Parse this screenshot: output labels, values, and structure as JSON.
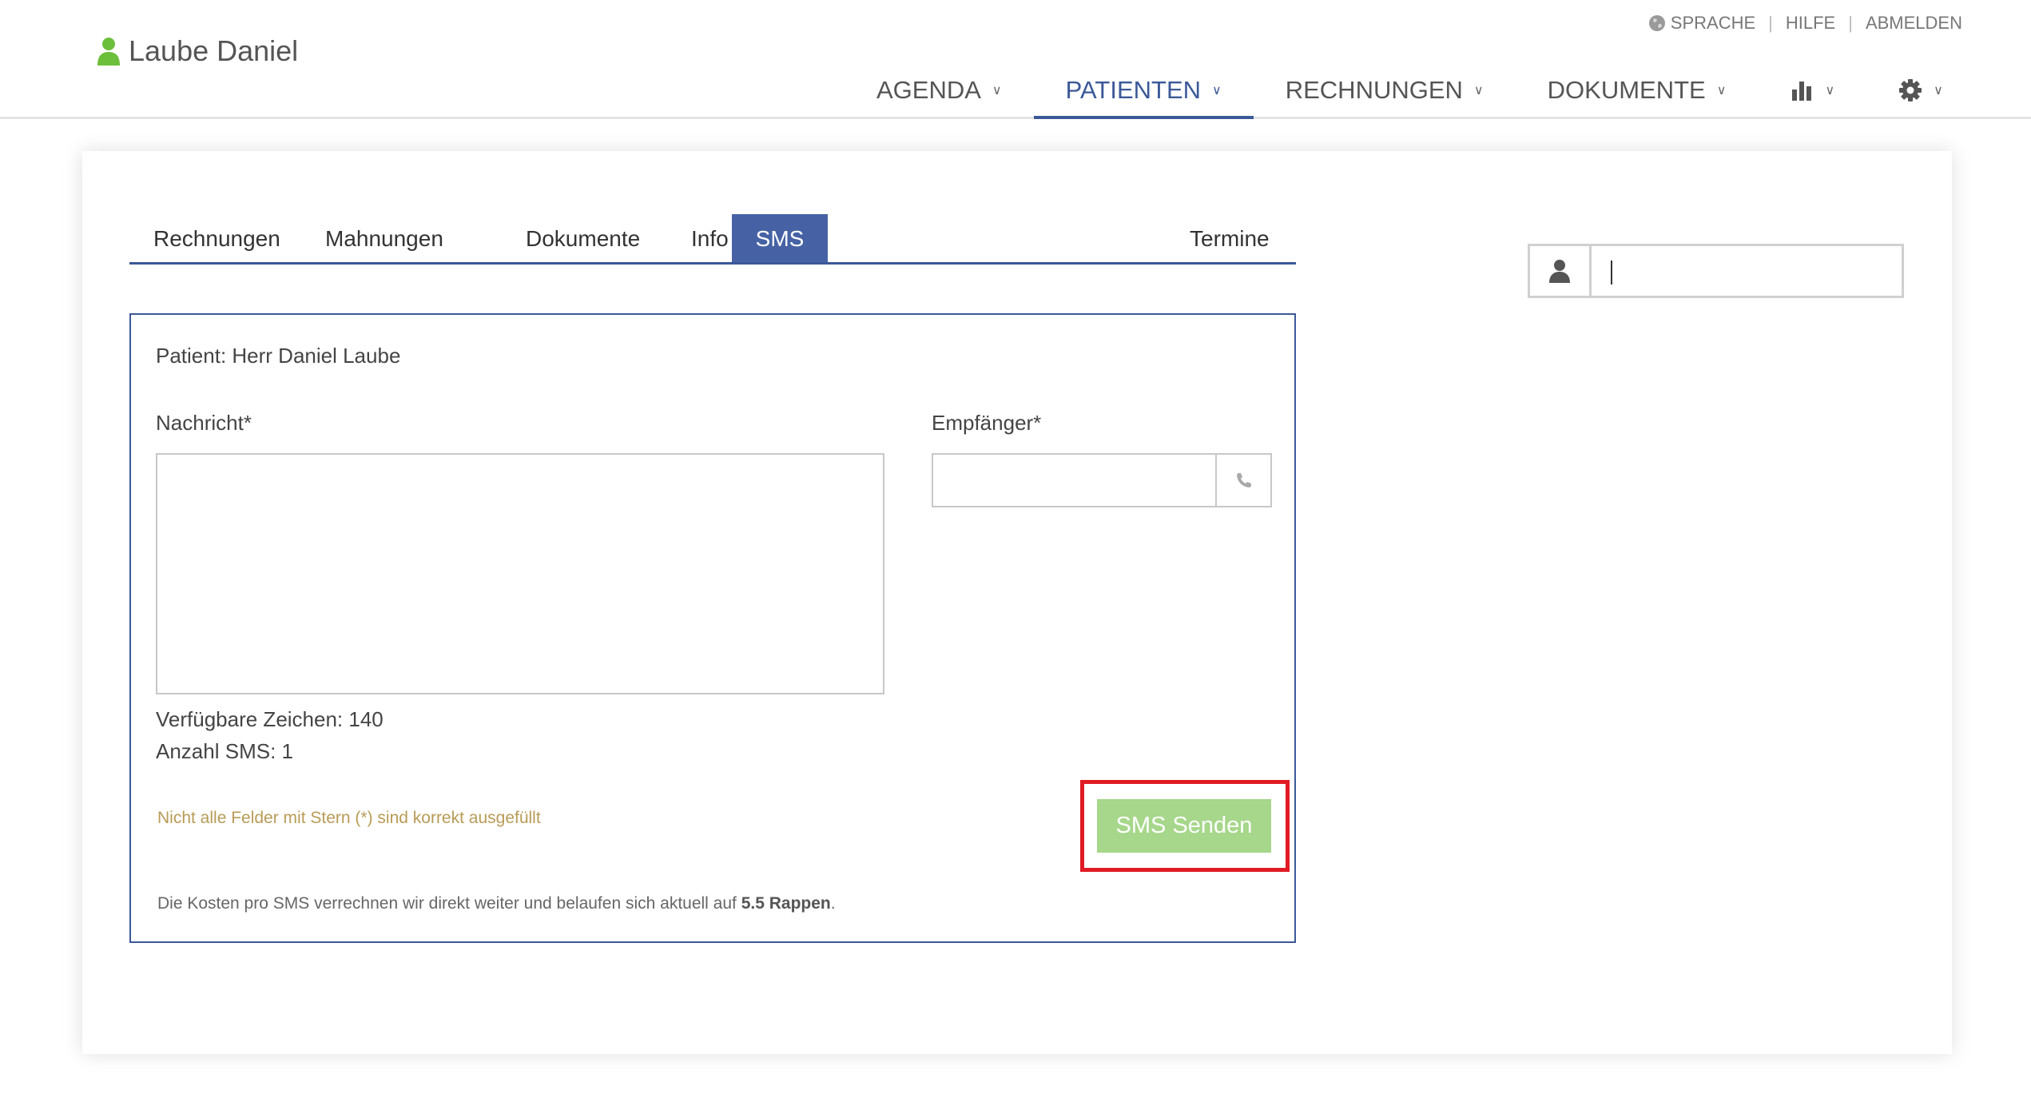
{
  "header": {
    "user_name": "Laube Daniel",
    "top_links": {
      "language": "SPRACHE",
      "help": "HILFE",
      "logout": "ABMELDEN"
    },
    "nav": [
      {
        "label": "AGENDA",
        "active": false
      },
      {
        "label": "PATIENTEN",
        "active": true
      },
      {
        "label": "RECHNUNGEN",
        "active": false
      },
      {
        "label": "DOKUMENTE",
        "active": false
      },
      {
        "icon": "bar-chart-icon"
      },
      {
        "icon": "gear-icon"
      }
    ]
  },
  "tabs": [
    {
      "label": "Rechnungen",
      "active": false
    },
    {
      "label": "Mahnungen",
      "active": false
    },
    {
      "label": "Dokumente",
      "active": false
    },
    {
      "label": "Info",
      "active": false
    },
    {
      "label": "SMS",
      "active": true
    },
    {
      "label": "Termine",
      "active": false
    }
  ],
  "sms_form": {
    "patient_line": "Patient: Herr Daniel Laube",
    "message_label": "Nachricht*",
    "message_value": "",
    "recipient_label": "Empfänger*",
    "recipient_value": "",
    "available_chars": "Verfügbare Zeichen: 140",
    "sms_count": "Anzahl SMS: 1",
    "validation_warning": "Nicht alle Felder mit Stern (*) sind korrekt ausgefüllt",
    "send_button": "SMS Senden",
    "cost_text_prefix": "Die Kosten pro SMS verrechnen wir direkt weiter und belaufen sich aktuell auf ",
    "cost_value": "5.5 Rappen",
    "cost_text_suffix": "."
  },
  "patient_search": {
    "value": ""
  },
  "colors": {
    "accent": "#3b5998",
    "active_tab": "#4662a5",
    "send_button": "#a6d78a",
    "user_icon": "#6cbf3a",
    "warning_text": "#b89b56",
    "highlight": "#e01b24"
  }
}
